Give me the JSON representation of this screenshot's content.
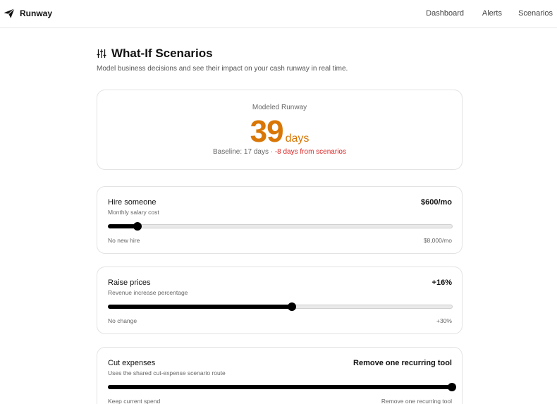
{
  "app": {
    "name": "Runway"
  },
  "nav": {
    "items": [
      "Dashboard",
      "Alerts",
      "Scenarios"
    ]
  },
  "page": {
    "title": "What-If Scenarios",
    "subtitle": "Model business decisions and see their impact on your cash runway in real time."
  },
  "runway": {
    "label": "Modeled Runway",
    "value": "39",
    "unit": "days",
    "baseline_text": "Baseline: 17 days · ",
    "delta_text": "-8 days from scenarios",
    "value_color": "#d97706",
    "delta_color": "#dc2626"
  },
  "scenarios": [
    {
      "title": "Hire someone",
      "description": "Monthly salary cost",
      "value": "$600/mo",
      "min_label": "No new hire",
      "max_label": "$8,000/mo",
      "level": 0.085
    },
    {
      "title": "Raise prices",
      "description": "Revenue increase percentage",
      "value": "+16%",
      "min_label": "No change",
      "max_label": "+30%",
      "level": 0.533
    },
    {
      "title": "Cut expenses",
      "description": "Uses the shared cut-expense scenario route",
      "value": "Remove one recurring tool",
      "min_label": "Keep current spend",
      "max_label": "Remove one recurring tool",
      "level": 1.0
    }
  ]
}
